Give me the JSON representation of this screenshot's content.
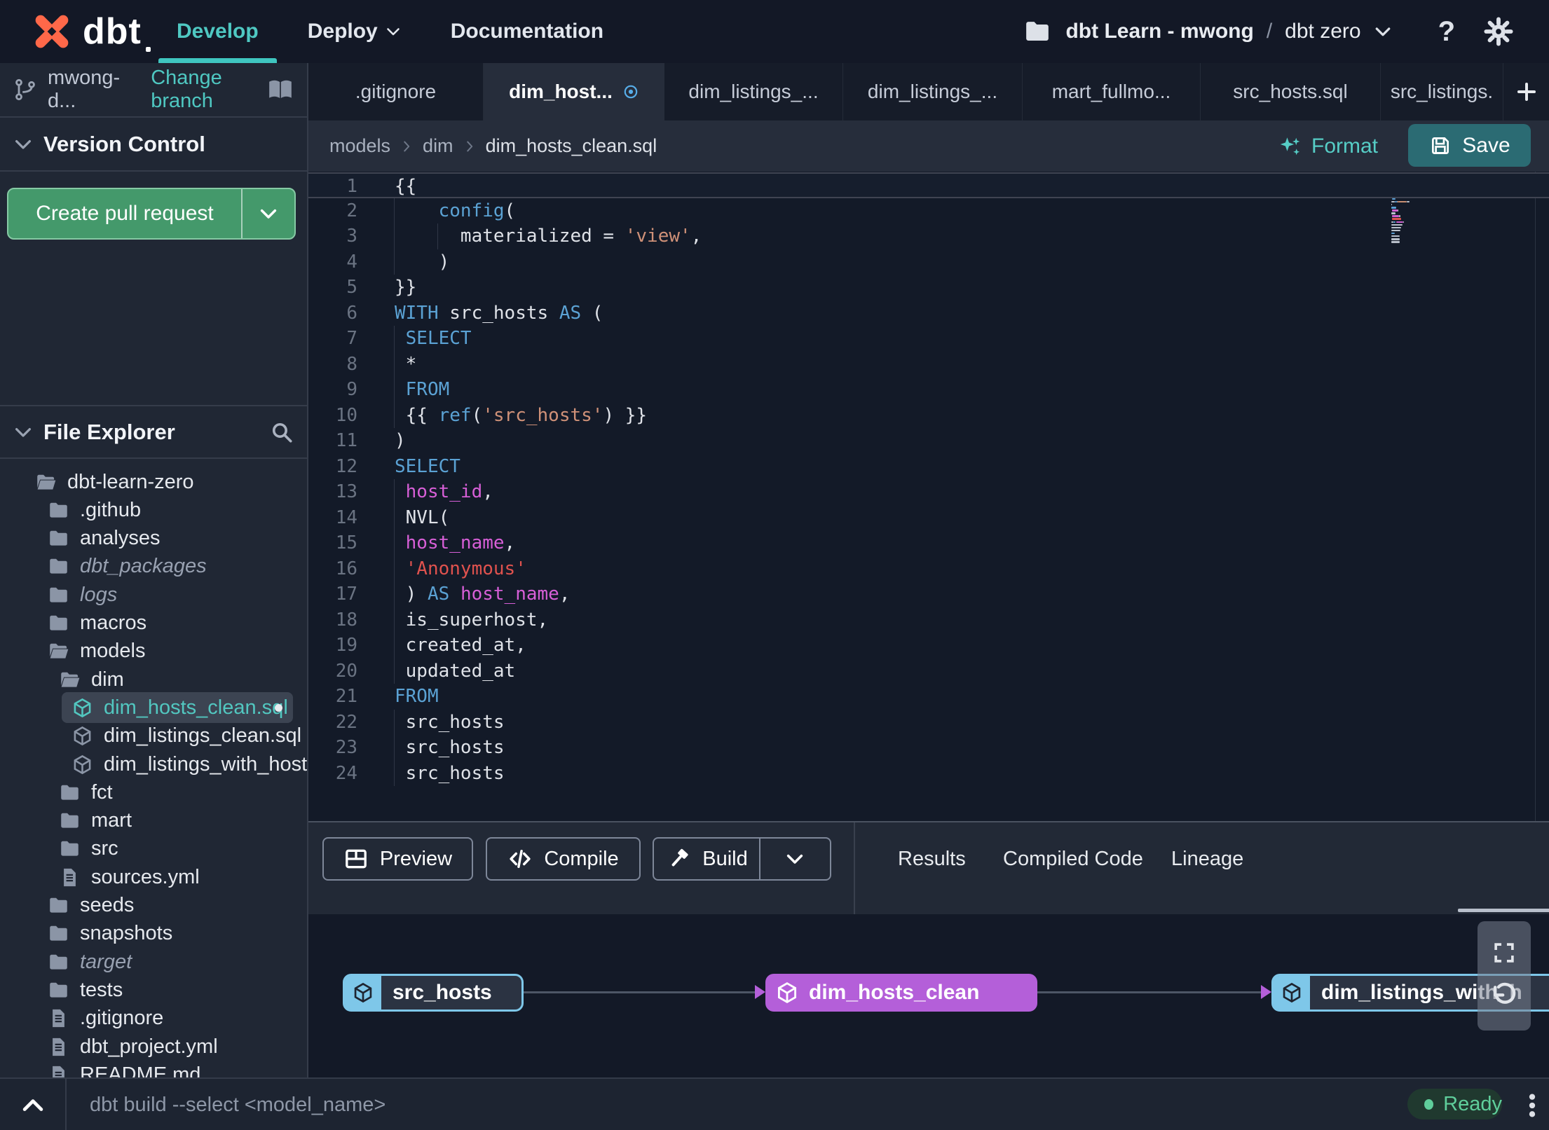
{
  "nav": {
    "brand": "dbt",
    "items": [
      {
        "label": "Develop",
        "active": true,
        "dropdown": false
      },
      {
        "label": "Deploy",
        "active": false,
        "dropdown": true
      },
      {
        "label": "Documentation",
        "active": false,
        "dropdown": false
      }
    ],
    "project": {
      "name": "dbt Learn - mwong",
      "separator": "/",
      "env": "dbt zero"
    }
  },
  "sidebar": {
    "branch": {
      "name": "mwong-d...",
      "action": "Change branch"
    },
    "version_control": {
      "title": "Version Control",
      "button": "Create pull request"
    },
    "file_explorer": {
      "title": "File Explorer",
      "tree": [
        {
          "label": "dbt-learn-zero",
          "icon": "folder-open",
          "level": 0
        },
        {
          "label": ".github",
          "icon": "folder",
          "level": 1
        },
        {
          "label": "analyses",
          "icon": "folder",
          "level": 1
        },
        {
          "label": "dbt_packages",
          "icon": "folder",
          "level": 1,
          "muted": true
        },
        {
          "label": "logs",
          "icon": "folder",
          "level": 1,
          "muted": true
        },
        {
          "label": "macros",
          "icon": "folder",
          "level": 1
        },
        {
          "label": "models",
          "icon": "folder-open",
          "level": 1
        },
        {
          "label": "dim",
          "icon": "folder-open",
          "level": 2
        },
        {
          "label": "dim_hosts_clean.sql",
          "icon": "model",
          "level": 3,
          "selected": true,
          "modified": true
        },
        {
          "label": "dim_listings_clean.sql",
          "icon": "model",
          "level": 3
        },
        {
          "label": "dim_listings_with_hosts...",
          "icon": "model",
          "level": 3
        },
        {
          "label": "fct",
          "icon": "folder",
          "level": 2
        },
        {
          "label": "mart",
          "icon": "folder",
          "level": 2
        },
        {
          "label": "src",
          "icon": "folder",
          "level": 2
        },
        {
          "label": "sources.yml",
          "icon": "file",
          "level": 2
        },
        {
          "label": "seeds",
          "icon": "folder",
          "level": 1
        },
        {
          "label": "snapshots",
          "icon": "folder",
          "level": 1
        },
        {
          "label": "target",
          "icon": "folder",
          "level": 1,
          "muted": true
        },
        {
          "label": "tests",
          "icon": "folder",
          "level": 1
        },
        {
          "label": ".gitignore",
          "icon": "file",
          "level": 1
        },
        {
          "label": "dbt_project.yml",
          "icon": "file",
          "level": 1
        },
        {
          "label": "README.md",
          "icon": "file",
          "level": 1
        }
      ]
    }
  },
  "editor_tabs": [
    {
      "label": ".gitignore"
    },
    {
      "label": "dim_host...",
      "active": true,
      "modified": true
    },
    {
      "label": "dim_listings_..."
    },
    {
      "label": "dim_listings_..."
    },
    {
      "label": "mart_fullmo..."
    },
    {
      "label": "src_hosts.sql"
    },
    {
      "label": "src_listings."
    }
  ],
  "breadcrumb": [
    "models",
    "dim",
    "dim_hosts_clean.sql"
  ],
  "actions": {
    "format": "Format",
    "save": "Save"
  },
  "code": {
    "lines": [
      {
        "n": 1,
        "active": true,
        "guides": [],
        "tokens": [
          [
            "{{",
            "pl"
          ]
        ]
      },
      {
        "n": 2,
        "guides": [
          0
        ],
        "tokens": [
          [
            "    ",
            "pl"
          ],
          [
            "config",
            "kw"
          ],
          [
            "(",
            "pl"
          ]
        ]
      },
      {
        "n": 3,
        "guides": [
          0,
          1
        ],
        "tokens": [
          [
            "      ",
            "pl"
          ],
          [
            "materialized = ",
            "pl"
          ],
          [
            "'view'",
            "str"
          ],
          [
            ",",
            "pl"
          ]
        ]
      },
      {
        "n": 4,
        "guides": [
          0
        ],
        "tokens": [
          [
            "    )",
            "pl"
          ]
        ]
      },
      {
        "n": 5,
        "guides": [],
        "tokens": [
          [
            "}}",
            "pl"
          ]
        ]
      },
      {
        "n": 6,
        "guides": [],
        "tokens": [
          [
            "WITH",
            "kw"
          ],
          [
            " src_hosts ",
            "pl"
          ],
          [
            "AS",
            "kw"
          ],
          [
            " (",
            "pl"
          ]
        ]
      },
      {
        "n": 7,
        "guides": [
          0
        ],
        "tokens": [
          [
            " ",
            "pl"
          ],
          [
            "SELECT",
            "kw"
          ]
        ]
      },
      {
        "n": 8,
        "guides": [
          0
        ],
        "tokens": [
          [
            " *",
            "pl"
          ]
        ]
      },
      {
        "n": 9,
        "guides": [
          0
        ],
        "tokens": [
          [
            " ",
            "pl"
          ],
          [
            "FROM",
            "kw"
          ]
        ]
      },
      {
        "n": 10,
        "guides": [
          0
        ],
        "tokens": [
          [
            " {{ ",
            "pl"
          ],
          [
            "ref",
            "kw"
          ],
          [
            "(",
            "pl"
          ],
          [
            "'src_hosts'",
            "str"
          ],
          [
            ") }}",
            "pl"
          ]
        ]
      },
      {
        "n": 11,
        "guides": [],
        "tokens": [
          [
            ")",
            "pl"
          ]
        ]
      },
      {
        "n": 12,
        "guides": [],
        "tokens": [
          [
            "SELECT",
            "kw"
          ]
        ]
      },
      {
        "n": 13,
        "guides": [
          0
        ],
        "tokens": [
          [
            " ",
            "pl"
          ],
          [
            "host_id",
            "ident"
          ],
          [
            ",",
            "pl"
          ]
        ]
      },
      {
        "n": 14,
        "guides": [
          0
        ],
        "tokens": [
          [
            " NVL(",
            "pl"
          ]
        ]
      },
      {
        "n": 15,
        "guides": [
          0
        ],
        "tokens": [
          [
            " ",
            "pl"
          ],
          [
            "host_name",
            "ident"
          ],
          [
            ",",
            "pl"
          ]
        ]
      },
      {
        "n": 16,
        "guides": [
          0
        ],
        "tokens": [
          [
            " ",
            "pl"
          ],
          [
            "'Anonymous'",
            "strr"
          ]
        ]
      },
      {
        "n": 17,
        "guides": [
          0
        ],
        "tokens": [
          [
            " ) ",
            "pl"
          ],
          [
            "AS",
            "kw"
          ],
          [
            " ",
            "pl"
          ],
          [
            "host_name",
            "ident"
          ],
          [
            ",",
            "pl"
          ]
        ]
      },
      {
        "n": 18,
        "guides": [
          0
        ],
        "tokens": [
          [
            " is_superhost,",
            "pl"
          ]
        ]
      },
      {
        "n": 19,
        "guides": [
          0
        ],
        "tokens": [
          [
            " created_at,",
            "pl"
          ]
        ]
      },
      {
        "n": 20,
        "guides": [
          0
        ],
        "tokens": [
          [
            " updated_at",
            "pl"
          ]
        ]
      },
      {
        "n": 21,
        "guides": [],
        "tokens": [
          [
            "FROM",
            "kw"
          ]
        ]
      },
      {
        "n": 22,
        "guides": [
          0
        ],
        "tokens": [
          [
            " src_hosts",
            "pl"
          ]
        ]
      },
      {
        "n": 23,
        "guides": [
          0
        ],
        "tokens": [
          [
            " src_hosts",
            "pl"
          ]
        ]
      },
      {
        "n": 24,
        "guides": [
          0
        ],
        "tokens": [
          [
            " src_hosts",
            "pl"
          ]
        ]
      }
    ]
  },
  "bottom_panel": {
    "buttons": [
      {
        "label": "Preview",
        "icon": "grid"
      },
      {
        "label": "Compile",
        "icon": "code"
      },
      {
        "label": "Build",
        "icon": "hammer",
        "split": true
      }
    ],
    "tabs": [
      {
        "label": "Results"
      },
      {
        "label": "Compiled Code"
      },
      {
        "label": "Lineage",
        "active": true
      }
    ]
  },
  "lineage": {
    "nodes": [
      {
        "label": "src_hosts",
        "kind": "outline"
      },
      {
        "label": "dim_hosts_clean",
        "kind": "filled"
      },
      {
        "label": "dim_listings_with_h",
        "kind": "outline"
      }
    ]
  },
  "command_bar": {
    "placeholder": "dbt build --select <model_name>",
    "status": "Ready"
  },
  "colors": {
    "accent_teal": "#4fc8c2",
    "pr_green": "#44996b",
    "save_teal": "#2b6b73",
    "node_blue": "#7ec7e9",
    "node_purple": "#b45fd9",
    "ready_green": "#5fce9b",
    "kw_blue": "#5ba2d4",
    "string_salmon": "#cf9178",
    "string_red": "#e0524e",
    "ident_magenta": "#d75fd7",
    "logo_orange": "#ff6849"
  }
}
